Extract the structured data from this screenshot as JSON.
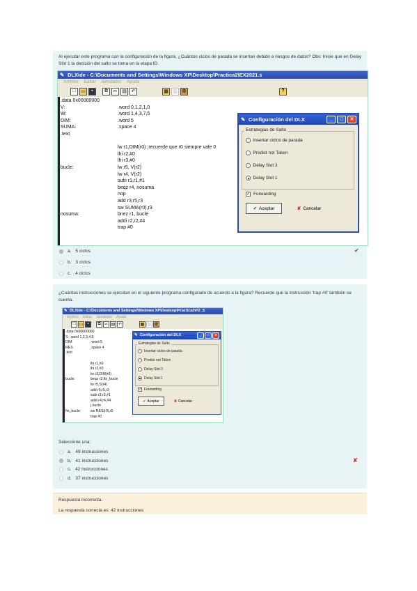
{
  "q1": {
    "text": "Al ejecutar este programa con la configuración de la figura, ¿Cuántos ciclos de parada se insertan debido a riesgos de datos? Obs: Inicie que en Delay Slot 1 la decisión del salto se toma en la etapa ID.",
    "window_title": "DLXide - C:\\Documents and Settings\\Windows XP\\Desktop\\Practica2\\EX2021.s",
    "menu": [
      "Archivo",
      "Editar",
      "Simulador",
      "Ayuda"
    ],
    "toolbar_help": "?",
    "code": [
      {
        "label": ".data 0x00000000",
        "instr": ""
      },
      {
        "label": "V:",
        "instr": ".word 0,1,2,1,0"
      },
      {
        "label": "W:",
        "instr": ".word 1,4,3,7,5"
      },
      {
        "label": "DIM:",
        "instr": ".word 5"
      },
      {
        "label": "SUMA:",
        "instr": ".space 4"
      },
      {
        "label": ".text",
        "instr": ""
      },
      {
        "label": "",
        "instr": ""
      },
      {
        "label": "",
        "instr": "lw r1,DIM(r0) ;recuerde que r0 siempre vale 0"
      },
      {
        "label": "",
        "instr": "lhi r2,#0"
      },
      {
        "label": "",
        "instr": "lhi r3,#0"
      },
      {
        "label": "bucle:",
        "instr": "lw r5, V(r2)"
      },
      {
        "label": "",
        "instr": "lw r4, V(r2)"
      },
      {
        "label": "",
        "instr": "subi r1,r1,#1"
      },
      {
        "label": "",
        "instr": "beqz r4, nosuma"
      },
      {
        "label": "",
        "instr": "nop"
      },
      {
        "label": "",
        "instr": "add r3,r5,r3"
      },
      {
        "label": "",
        "instr": "sw SUMA(r0),r3"
      },
      {
        "label": "nosuma:",
        "instr": "bnez r1, bucle"
      },
      {
        "label": "",
        "instr": "addi r2,r2,#4"
      },
      {
        "label": "",
        "instr": "trap #0"
      }
    ],
    "options": [
      {
        "letter": "a.",
        "text": "5 ciclos",
        "selected": true
      },
      {
        "letter": "b.",
        "text": "3 ciclos",
        "selected": false
      },
      {
        "letter": "c.",
        "text": "4 ciclos",
        "selected": false
      }
    ],
    "mark": "✔",
    "mark_color": "#3c8a3c"
  },
  "dialog": {
    "title": "Configuración del DLX",
    "group": "Estrategias de Salto",
    "options": [
      "Insertar ciclos de parada",
      "Predict not Taken",
      "Delay Slot 3",
      "Delay Slot 1"
    ],
    "selected_index": 3,
    "forwarding": "Forwarding",
    "accept": "Aceptar",
    "cancel": "Cancelar"
  },
  "q2": {
    "text": "¿Cuántas instrucciones se ejecutan en el siguiente programa configurado de acuerdo a la figura? Recuerde que la instrucción 'trap #0' también se cuenta.",
    "window_title": "DLXide - C:\\Documents and Settings\\Windows XP\\Desktop\\Practica2\\P2_S",
    "menu": [
      "Archivo",
      "Editar",
      "Simulador",
      "Ayuda"
    ],
    "code": [
      {
        "label": ".data 0x00000000",
        "instr": ""
      },
      {
        "label": "S: .word 1,2,3,4,5",
        "instr": ""
      },
      {
        "label": "DIM",
        "instr": ".word 5"
      },
      {
        "label": "RES",
        "instr": ".space 4"
      },
      {
        "label": ".text",
        "instr": ""
      },
      {
        "label": "",
        "instr": ""
      },
      {
        "label": "",
        "instr": "lhi r1,#0"
      },
      {
        "label": "",
        "instr": "lhi r2,#0"
      },
      {
        "label": "",
        "instr": "lw r3,DIM(r0)"
      },
      {
        "label": "bucle:",
        "instr": "beqz r3,fin_bucle"
      },
      {
        "label": "",
        "instr": "lw r5,S(r4)"
      },
      {
        "label": "",
        "instr": "add r5,r5,r3"
      },
      {
        "label": "",
        "instr": "subi r3,r3,#1"
      },
      {
        "label": "",
        "instr": "addi r4,r4,#4"
      },
      {
        "label": "",
        "instr": "j bucle"
      },
      {
        "label": "fin_bucle:",
        "instr": "sw RES(r0),r5"
      },
      {
        "label": "",
        "instr": "trap #0"
      }
    ],
    "prompt": "Seleccione una:",
    "options": [
      {
        "letter": "a.",
        "text": "49 instrucciones",
        "selected": false
      },
      {
        "letter": "b.",
        "text": "41 instrucciones",
        "selected": true
      },
      {
        "letter": "c.",
        "text": "42 instrucciones",
        "selected": false
      },
      {
        "letter": "d.",
        "text": "37 instrucciones",
        "selected": false
      }
    ],
    "mark": "✘",
    "mark_color": "#c0392b"
  },
  "feedback": {
    "status": "Respuesta incorrecta.",
    "correct": "La respuesta correcta es: 42 instrucciones"
  }
}
